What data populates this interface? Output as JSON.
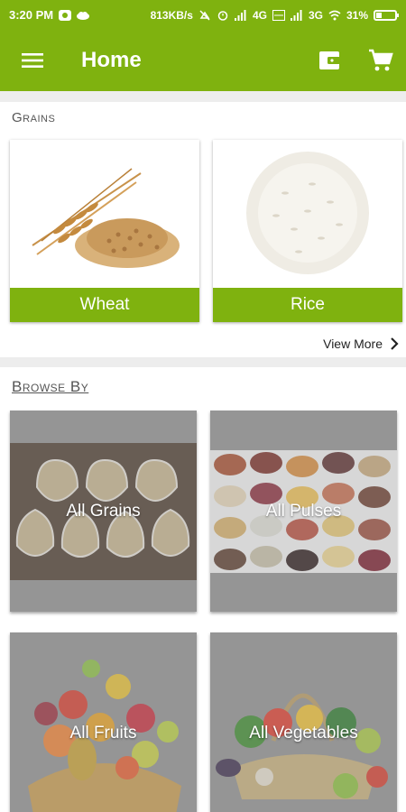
{
  "status_bar": {
    "time": "3:20 PM",
    "speed": "813KB/s",
    "net1": "4G",
    "net2": "3G",
    "battery": "31%",
    "battery_level": 0.31
  },
  "app_bar": {
    "title": "Home",
    "icons": [
      "menu-icon",
      "wallet-icon",
      "cart-icon"
    ]
  },
  "grains": {
    "title": "Grains",
    "items": [
      {
        "label": "Wheat"
      },
      {
        "label": "Rice"
      }
    ],
    "view_more": "View More"
  },
  "browse": {
    "title": "Browse By",
    "tiles": [
      {
        "label": "All Grains"
      },
      {
        "label": "All Pulses"
      },
      {
        "label": "All Fruits"
      },
      {
        "label": "All Vegetables"
      }
    ]
  },
  "colors": {
    "brand": "#7fb20f",
    "background": "#ededed"
  }
}
